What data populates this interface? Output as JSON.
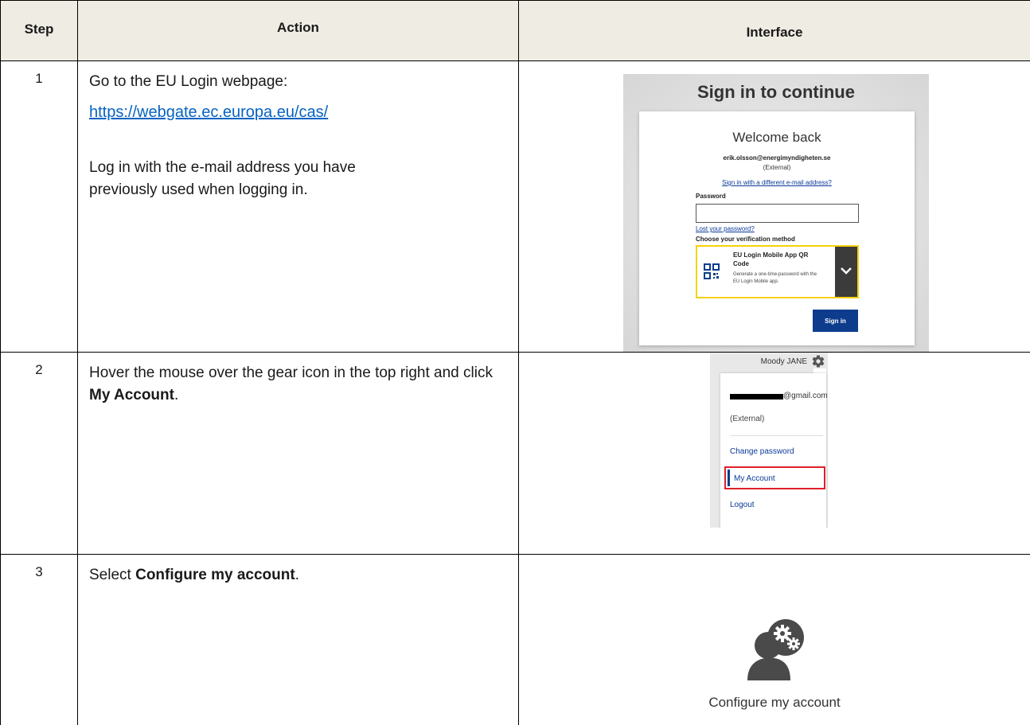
{
  "header": {
    "step": "Step",
    "action": "Action",
    "interface": "Interface"
  },
  "rows": [
    {
      "step": "1",
      "line1": "Go to the EU Login webpage:",
      "link": "https://webgate.ec.europa.eu/cas/",
      "line2": "Log in with the e-mail address you have previously used when logging in.",
      "shot": {
        "title": "Sign in to continue",
        "welcome": "Welcome back",
        "email": "erik.olsson@energimyndigheten.se",
        "external": "(External)",
        "different": "Sign in with a different e-mail address?",
        "password_label": "Password",
        "lost": "Lost your password?",
        "choose": "Choose your verification method",
        "method_title": "EU Login Mobile App QR Code",
        "method_desc": "Generate a one-time-password with the EU Login Mobile app.",
        "signin": "Sign in"
      }
    },
    {
      "step": "2",
      "action_pre": "Hover the mouse over the gear icon in the top right and click ",
      "action_bold": "My Account",
      "action_post": ".",
      "shot": {
        "user": "Moody JANE",
        "email_suffix": "@gmail.com",
        "external": "(External)",
        "change_password": "Change password",
        "my_account": "My Account",
        "logout": "Logout"
      }
    },
    {
      "step": "3",
      "action_pre": "Select ",
      "action_bold": "Configure my account",
      "action_post": ".",
      "shot": {
        "label": "Configure my account"
      }
    }
  ],
  "colors": {
    "header_bg": "#efece3",
    "link": "#0563c1",
    "eu_blue": "#0d3c8c",
    "highlight_yellow": "#f5d20b",
    "highlight_red": "#e0202a"
  }
}
